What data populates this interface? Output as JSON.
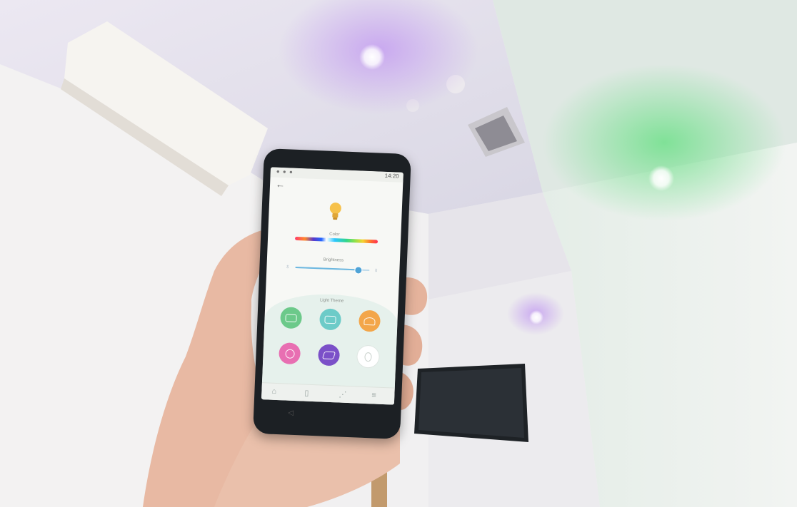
{
  "scene": {
    "description_colors": {
      "purple_glow": "#b995e6",
      "green_glow": "#6fe08a",
      "wall": "#eeeeee"
    }
  },
  "phone": {
    "status_time": "14:20",
    "screen": {
      "color_label": "Color",
      "brightness_label": "Brightness",
      "brightness_level": 0.85,
      "light_theme_label": "Light Theme",
      "themes": [
        {
          "color": "#6cc98a"
        },
        {
          "color": "#6ccbc8"
        },
        {
          "color": "#f3a64a"
        },
        {
          "color": "#e86fb2"
        },
        {
          "color": "#7b50c8"
        },
        {
          "color": "#ffffff"
        }
      ],
      "nav_icons": [
        "home-icon",
        "device-icon",
        "connect-icon",
        "menu-icon"
      ]
    }
  }
}
